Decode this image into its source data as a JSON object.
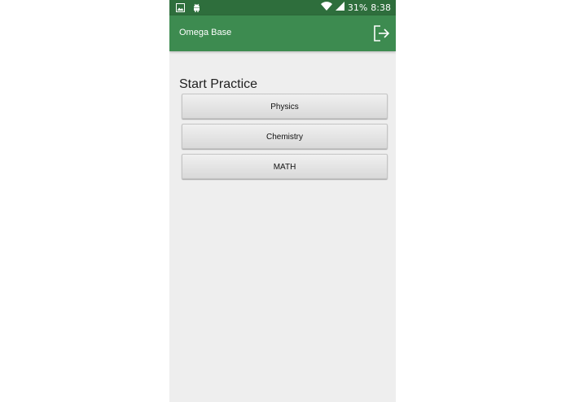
{
  "status_bar": {
    "icons_left": [
      "image-icon",
      "android-icon"
    ],
    "icons_right": [
      "wifi-icon",
      "signal-icon"
    ],
    "battery_percent": "31%",
    "time": "8:38"
  },
  "app_bar": {
    "title": "Omega Base",
    "logout_icon": "logout-icon"
  },
  "main": {
    "section_title": "Start Practice",
    "buttons": [
      {
        "label": "Physics"
      },
      {
        "label": "Chemistry"
      },
      {
        "label": "MATH"
      }
    ]
  },
  "colors": {
    "status_bar": "#2e6e3c",
    "app_bar": "#3d8b50",
    "background": "#eeeeee"
  }
}
